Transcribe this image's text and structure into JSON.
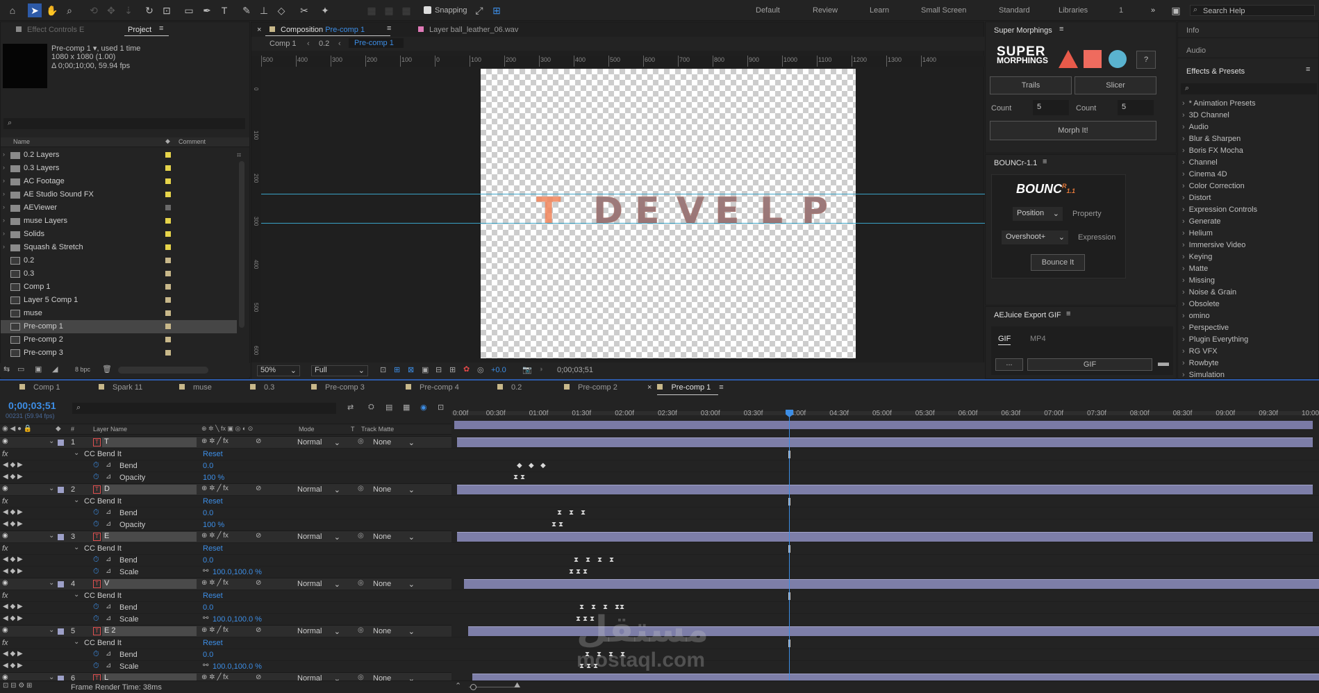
{
  "toolbar": {
    "snapping": "Snapping",
    "workspaces": [
      "Default",
      "Review",
      "Learn",
      "Small Screen",
      "Standard",
      "Libraries"
    ],
    "workspace_count": "1",
    "search_placeholder": "Search Help"
  },
  "project": {
    "tabs": [
      "Effect Controls E",
      "Project"
    ],
    "item_name": "Pre-comp 1",
    "item_used": ", used 1 time",
    "item_size": "1080 x 1080 (1.00)",
    "item_duration": "Δ 0;00;10;00, 59.94 fps",
    "columns": [
      "Name",
      "Comment"
    ],
    "items": [
      {
        "name": "0.2 Layers",
        "type": "folder",
        "color": "#e6d44a"
      },
      {
        "name": "0.3 Layers",
        "type": "folder",
        "color": "#e6d44a"
      },
      {
        "name": "AC Footage",
        "type": "folder",
        "color": "#e6d44a"
      },
      {
        "name": "AE Studio Sound FX",
        "type": "folder",
        "color": "#e6d44a"
      },
      {
        "name": "AEViewer",
        "type": "folder",
        "color": "#6a6a6a"
      },
      {
        "name": "muse Layers",
        "type": "folder",
        "color": "#e6d44a"
      },
      {
        "name": "Solids",
        "type": "folder",
        "color": "#e6d44a"
      },
      {
        "name": "Squash & Stretch",
        "type": "folder",
        "color": "#e6d44a"
      },
      {
        "name": "0.2",
        "type": "comp",
        "color": "#c8b88a"
      },
      {
        "name": "0.3",
        "type": "comp",
        "color": "#c8b88a"
      },
      {
        "name": "Comp 1",
        "type": "comp",
        "color": "#c8b88a"
      },
      {
        "name": "Layer 5 Comp 1",
        "type": "comp",
        "color": "#c8b88a"
      },
      {
        "name": "muse",
        "type": "comp",
        "color": "#c8b88a"
      },
      {
        "name": "Pre-comp 1",
        "type": "comp",
        "color": "#c8b88a"
      },
      {
        "name": "Pre-comp 2",
        "type": "comp",
        "color": "#c8b88a"
      },
      {
        "name": "Pre-comp 3",
        "type": "comp",
        "color": "#c8b88a"
      }
    ],
    "bpc": "8 bpc"
  },
  "comp": {
    "tab_prefix": "Composition",
    "tab_name": "Pre-comp 1",
    "layer_tab": "Layer  ball_leather_06.wav",
    "breadcrumbs": [
      "Comp 1",
      "0.2",
      "Pre-comp 1"
    ],
    "ruler_top": [
      "500",
      "400",
      "300",
      "200",
      "100",
      "0",
      "100",
      "200",
      "300",
      "400",
      "500",
      "600",
      "700",
      "800",
      "900",
      "1000",
      "1100",
      "1200",
      "1300",
      "1400"
    ],
    "ruler_left": [
      "0",
      "100",
      "200",
      "300",
      "400",
      "500",
      "600"
    ],
    "text_letters": [
      "T",
      "D",
      "E",
      "V",
      "E",
      "L",
      "P"
    ],
    "zoom": "50%",
    "resolution": "Full",
    "exposure": "+0.0",
    "timecode": "0;00;03;51"
  },
  "super_morphings": {
    "title": "Super Morphings",
    "logo": [
      "SUPER",
      "MORPHINGS"
    ],
    "help": "?",
    "buttons": [
      "Trails",
      "Slicer"
    ],
    "count_label": "Count",
    "count1": "5",
    "count2": "5",
    "morph": "Morph It!"
  },
  "bouncr": {
    "title": "BOUNCr-1.1",
    "logo": "BOUNC",
    "logo_super": "R",
    "logo_version": "1.1",
    "dropdown1": "Position",
    "label1": "Property",
    "dropdown2": "Overshoot+",
    "label2": "Expression",
    "bounce": "Bounce It"
  },
  "aejuice": {
    "title": "AEJuice Export GIF",
    "tabs": [
      "GIF",
      "MP4"
    ],
    "button": "GIF"
  },
  "right": {
    "tabs": [
      "Info",
      "Audio",
      "Effects & Presets"
    ],
    "items": [
      "* Animation Presets",
      "3D Channel",
      "Audio",
      "Blur & Sharpen",
      "Boris FX Mocha",
      "Channel",
      "Cinema 4D",
      "Color Correction",
      "Distort",
      "Expression Controls",
      "Generate",
      "Helium",
      "Immersive Video",
      "Keying",
      "Matte",
      "Missing",
      "Noise & Grain",
      "Obsolete",
      "omino",
      "Perspective",
      "Plugin Everything",
      "RG VFX",
      "Rowbyte",
      "Simulation"
    ]
  },
  "timeline": {
    "tabs": [
      {
        "name": "Comp 1",
        "color": "#c8b88a"
      },
      {
        "name": "Spark 11",
        "color": "#c8b88a"
      },
      {
        "name": "muse",
        "color": "#c8b88a"
      },
      {
        "name": "0.3",
        "color": "#c8b88a"
      },
      {
        "name": "Pre-comp 3",
        "color": "#c8b88a"
      },
      {
        "name": "Pre-comp 4",
        "color": "#c8b88a"
      },
      {
        "name": "0.2",
        "color": "#c8b88a"
      },
      {
        "name": "Pre-comp 2",
        "color": "#c8b88a"
      },
      {
        "name": "Pre-comp 1",
        "color": "#c8b88a"
      }
    ],
    "timecode": "0;00;03;51",
    "frames": "00231 (59.94 fps)",
    "col_layer": "Layer Name",
    "col_hash": "#",
    "col_mode": "Mode",
    "col_t": "T",
    "col_matte": "Track Matte",
    "time_labels": [
      "0:00f",
      "00:30f",
      "01:00f",
      "01:30f",
      "02:00f",
      "02:30f",
      "03:00f",
      "03:30f",
      "04:00f",
      "04:30f",
      "05:00f",
      "05:30f",
      "06:00f",
      "06:30f",
      "07:00f",
      "07:30f",
      "08:00f",
      "08:30f",
      "09:00f",
      "09:30f",
      "10:00"
    ],
    "current_time_fraction": 0.39,
    "layers": [
      {
        "num": "1",
        "name": "T",
        "mode": "Normal",
        "matte": "None",
        "fx": "CC Bend It",
        "reset": "Reset",
        "p1": "Bend",
        "v1": "0.0",
        "p2": "Opacity",
        "v2": "100 %"
      },
      {
        "num": "2",
        "name": "D",
        "mode": "Normal",
        "matte": "None",
        "fx": "CC Bend It",
        "reset": "Reset",
        "p1": "Bend",
        "v1": "0.0",
        "p2": "Opacity",
        "v2": "100 %"
      },
      {
        "num": "3",
        "name": "E",
        "mode": "Normal",
        "matte": "None",
        "fx": "CC Bend It",
        "reset": "Reset",
        "p1": "Bend",
        "v1": "0.0",
        "p2": "Scale",
        "v2": "100.0,100.0 %"
      },
      {
        "num": "4",
        "name": "V",
        "mode": "Normal",
        "matte": "None",
        "fx": "CC Bend It",
        "reset": "Reset",
        "p1": "Bend",
        "v1": "0.0",
        "p2": "Scale",
        "v2": "100.0,100.0 %"
      },
      {
        "num": "5",
        "name": "E 2",
        "mode": "Normal",
        "matte": "None",
        "fx": "CC Bend It",
        "reset": "Reset",
        "p1": "Bend",
        "v1": "0.0",
        "p2": "Scale",
        "v2": "100.0,100.0 %"
      },
      {
        "num": "6",
        "name": "L",
        "mode": "Normal",
        "matte": "None"
      }
    ],
    "render_time": "Frame Render Time:  38ms"
  },
  "watermark": {
    "arabic": "مستقل",
    "latin": "mostaql.com"
  }
}
